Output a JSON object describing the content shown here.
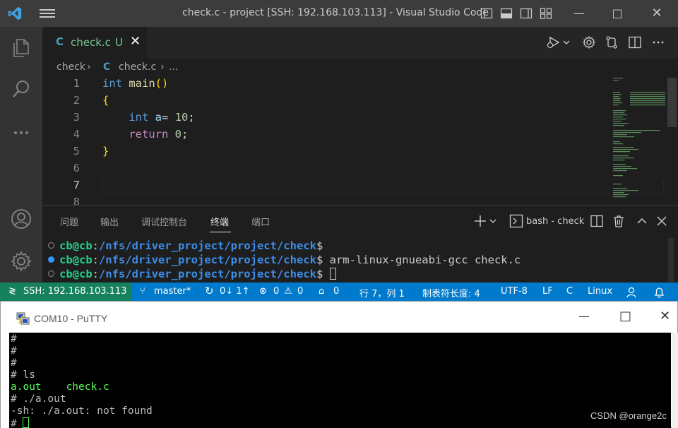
{
  "vscode": {
    "window_title": "check.c - project [SSH: 192.168.103.113] - Visual Studio Code",
    "tab": {
      "icon_letter": "C",
      "filename": "check.c",
      "status": "U"
    },
    "breadcrumb": {
      "folder": "check",
      "icon_letter": "C",
      "file": "check.c",
      "rest": "..."
    },
    "code_lines": [
      {
        "num": "1",
        "tokens": [
          {
            "t": "int",
            "c": "kw"
          },
          {
            "t": " "
          },
          {
            "t": "main",
            "c": "fn"
          },
          {
            "t": "()",
            "c": "br"
          }
        ]
      },
      {
        "num": "2",
        "tokens": [
          {
            "t": "{",
            "c": "br"
          }
        ]
      },
      {
        "num": "3",
        "tokens": [
          {
            "t": "    "
          },
          {
            "t": "int",
            "c": "kw"
          },
          {
            "t": " "
          },
          {
            "t": "a",
            "c": "var"
          },
          {
            "t": "= "
          },
          {
            "t": "10",
            "c": "num"
          },
          {
            "t": ";"
          }
        ]
      },
      {
        "num": "4",
        "tokens": [
          {
            "t": "    "
          },
          {
            "t": "return",
            "c": "kw2"
          },
          {
            "t": " "
          },
          {
            "t": "0",
            "c": "num"
          },
          {
            "t": ";"
          }
        ]
      },
      {
        "num": "5",
        "tokens": [
          {
            "t": "}",
            "c": "br"
          }
        ]
      },
      {
        "num": "6",
        "tokens": []
      },
      {
        "num": "7",
        "tokens": []
      },
      {
        "num": "8",
        "tokens": []
      }
    ],
    "active_line": "7",
    "panel": {
      "tabs": [
        "问题",
        "输出",
        "调试控制台",
        "终端",
        "端口"
      ],
      "active_tab": "终端",
      "terminal_name": "bash - check",
      "lines": [
        {
          "user": "cb@cb",
          "path": "/nfs/driver_project/project/check",
          "cmd": "",
          "dot": "hollow"
        },
        {
          "user": "cb@cb",
          "path": "/nfs/driver_project/project/check",
          "cmd": " arm-linux-gnueabi-gcc check.c",
          "dot": "blue"
        },
        {
          "user": "cb@cb",
          "path": "/nfs/driver_project/project/check",
          "cmd": " ",
          "dot": "hollow"
        }
      ]
    },
    "status_bar": {
      "remote": "SSH: 192.168.103.113",
      "branch": "master*",
      "sync": "0↓ 1↑",
      "errors": "0",
      "warnings": "0",
      "ports": "0",
      "cursor_pos": "行 7，列 1",
      "indent": "制表符长度: 4",
      "encoding": "UTF-8",
      "eol": "LF",
      "language": "C",
      "os": "Linux"
    },
    "colors": {
      "status_bar": "#007acc",
      "remote": "#16825d",
      "editor_bg": "#1e1e1e"
    }
  },
  "putty": {
    "title": "COM10 - PuTTY",
    "lines": [
      {
        "parts": [
          {
            "t": "#"
          }
        ]
      },
      {
        "parts": [
          {
            "t": "#"
          }
        ]
      },
      {
        "parts": [
          {
            "t": "#"
          }
        ]
      },
      {
        "parts": [
          {
            "t": "# ls"
          }
        ]
      },
      {
        "parts": [
          {
            "t": "a.out",
            "g": true
          },
          {
            "t": "    "
          },
          {
            "t": "check.c",
            "g": true
          }
        ]
      },
      {
        "parts": [
          {
            "t": "# ./a.out"
          }
        ]
      },
      {
        "parts": [
          {
            "t": "-sh: ./a.out: not found"
          }
        ]
      },
      {
        "parts": [
          {
            "t": "# "
          }
        ],
        "cursor": true
      }
    ],
    "watermark": "CSDN @orange2c"
  }
}
